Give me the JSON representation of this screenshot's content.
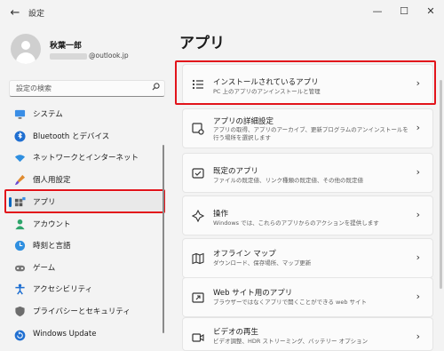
{
  "window": {
    "title": "設定",
    "back_icon": "back-arrow-icon",
    "minimize_glyph": "—",
    "maximize_glyph": "☐",
    "close_glyph": "✕"
  },
  "profile": {
    "name": "秋葉一郎",
    "email_suffix": "@outlook.jp"
  },
  "search": {
    "placeholder": "設定の検索"
  },
  "nav": {
    "items": [
      {
        "label": "システム",
        "icon": "monitor-icon"
      },
      {
        "label": "Bluetooth とデバイス",
        "icon": "bluetooth-icon"
      },
      {
        "label": "ネットワークとインターネット",
        "icon": "wifi-icon"
      },
      {
        "label": "個人用設定",
        "icon": "paintbrush-icon"
      },
      {
        "label": "アプリ",
        "icon": "apps-icon",
        "active": true
      },
      {
        "label": "アカウント",
        "icon": "person-icon"
      },
      {
        "label": "時刻と言語",
        "icon": "clock-globe-icon"
      },
      {
        "label": "ゲーム",
        "icon": "gamepad-icon"
      },
      {
        "label": "アクセシビリティ",
        "icon": "accessibility-icon"
      },
      {
        "label": "プライバシーとセキュリティ",
        "icon": "shield-icon"
      },
      {
        "label": "Windows Update",
        "icon": "update-icon"
      }
    ]
  },
  "main": {
    "title": "アプリ",
    "cards": [
      {
        "title": "インストールされているアプリ",
        "desc": "PC 上のアプリのアンインストールと管理",
        "icon": "list-icon"
      },
      {
        "title": "アプリの詳細設定",
        "desc": "アプリの取得、アプリのアーカイブ、更新プログラムのアンインストールを行う場所を選択します",
        "icon": "app-settings-icon"
      },
      {
        "title": "既定のアプリ",
        "desc": "ファイルの既定値、リンク種類の既定値、その他の既定値",
        "icon": "default-apps-icon"
      },
      {
        "title": "操作",
        "desc": "Windows では、これらのアプリからのアクションを提供します",
        "icon": "actions-icon"
      },
      {
        "title": "オフライン マップ",
        "desc": "ダウンロード、保存場所、マップ更新",
        "icon": "map-icon"
      },
      {
        "title": "Web サイト用のアプリ",
        "desc": "ブラウザーではなくアプリで開くことができる web サイト",
        "icon": "web-app-icon"
      },
      {
        "title": "ビデオの再生",
        "desc": "ビデオ調整、HDR ストリーミング、バッテリー オプション",
        "icon": "video-icon"
      }
    ]
  },
  "colors": {
    "accent": "#0067c0",
    "highlight": "#e2141b"
  }
}
